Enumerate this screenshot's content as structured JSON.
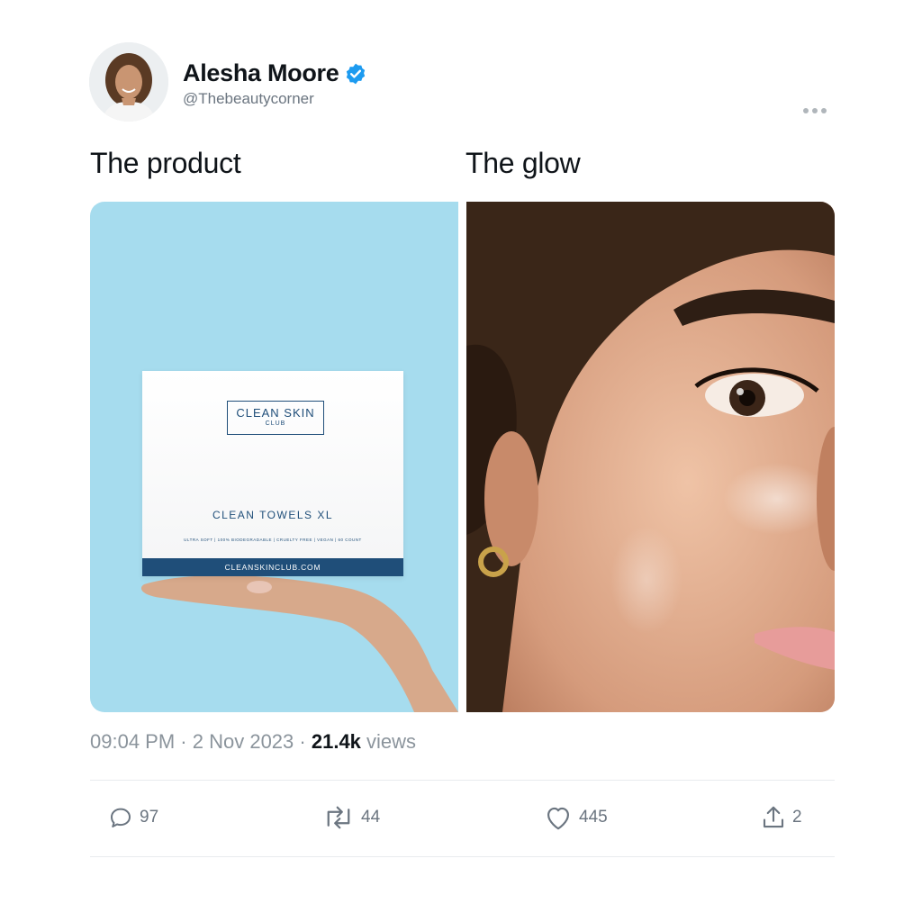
{
  "author": {
    "name": "Alesha Moore",
    "handle": "@Thebeautycorner",
    "verified": true,
    "accent_color": "#1d9bf0"
  },
  "captions": {
    "left": "The product",
    "right": "The glow"
  },
  "product_box": {
    "brand_line1": "CLEAN SKIN",
    "brand_line2": "CLUB",
    "title": "CLEAN TOWELS XL",
    "features": "ULTRA SOFT  |  100% BIODEGRADABLE  |  CRUELTY FREE  |  VEGAN  |  60 COUNT",
    "website": "CLEANSKINCLUB.COM",
    "brand_color": "#1f4e79"
  },
  "meta": {
    "time": "09:04 PM",
    "separator": "·",
    "date": "2 Nov 2023",
    "views_count": "21.4k",
    "views_label": "views"
  },
  "actions": {
    "replies": "97",
    "reposts": "44",
    "likes": "445",
    "shares": "2"
  },
  "icons": [
    "verified-badge-icon",
    "more-icon",
    "reply-icon",
    "repost-icon",
    "like-icon",
    "share-icon"
  ]
}
